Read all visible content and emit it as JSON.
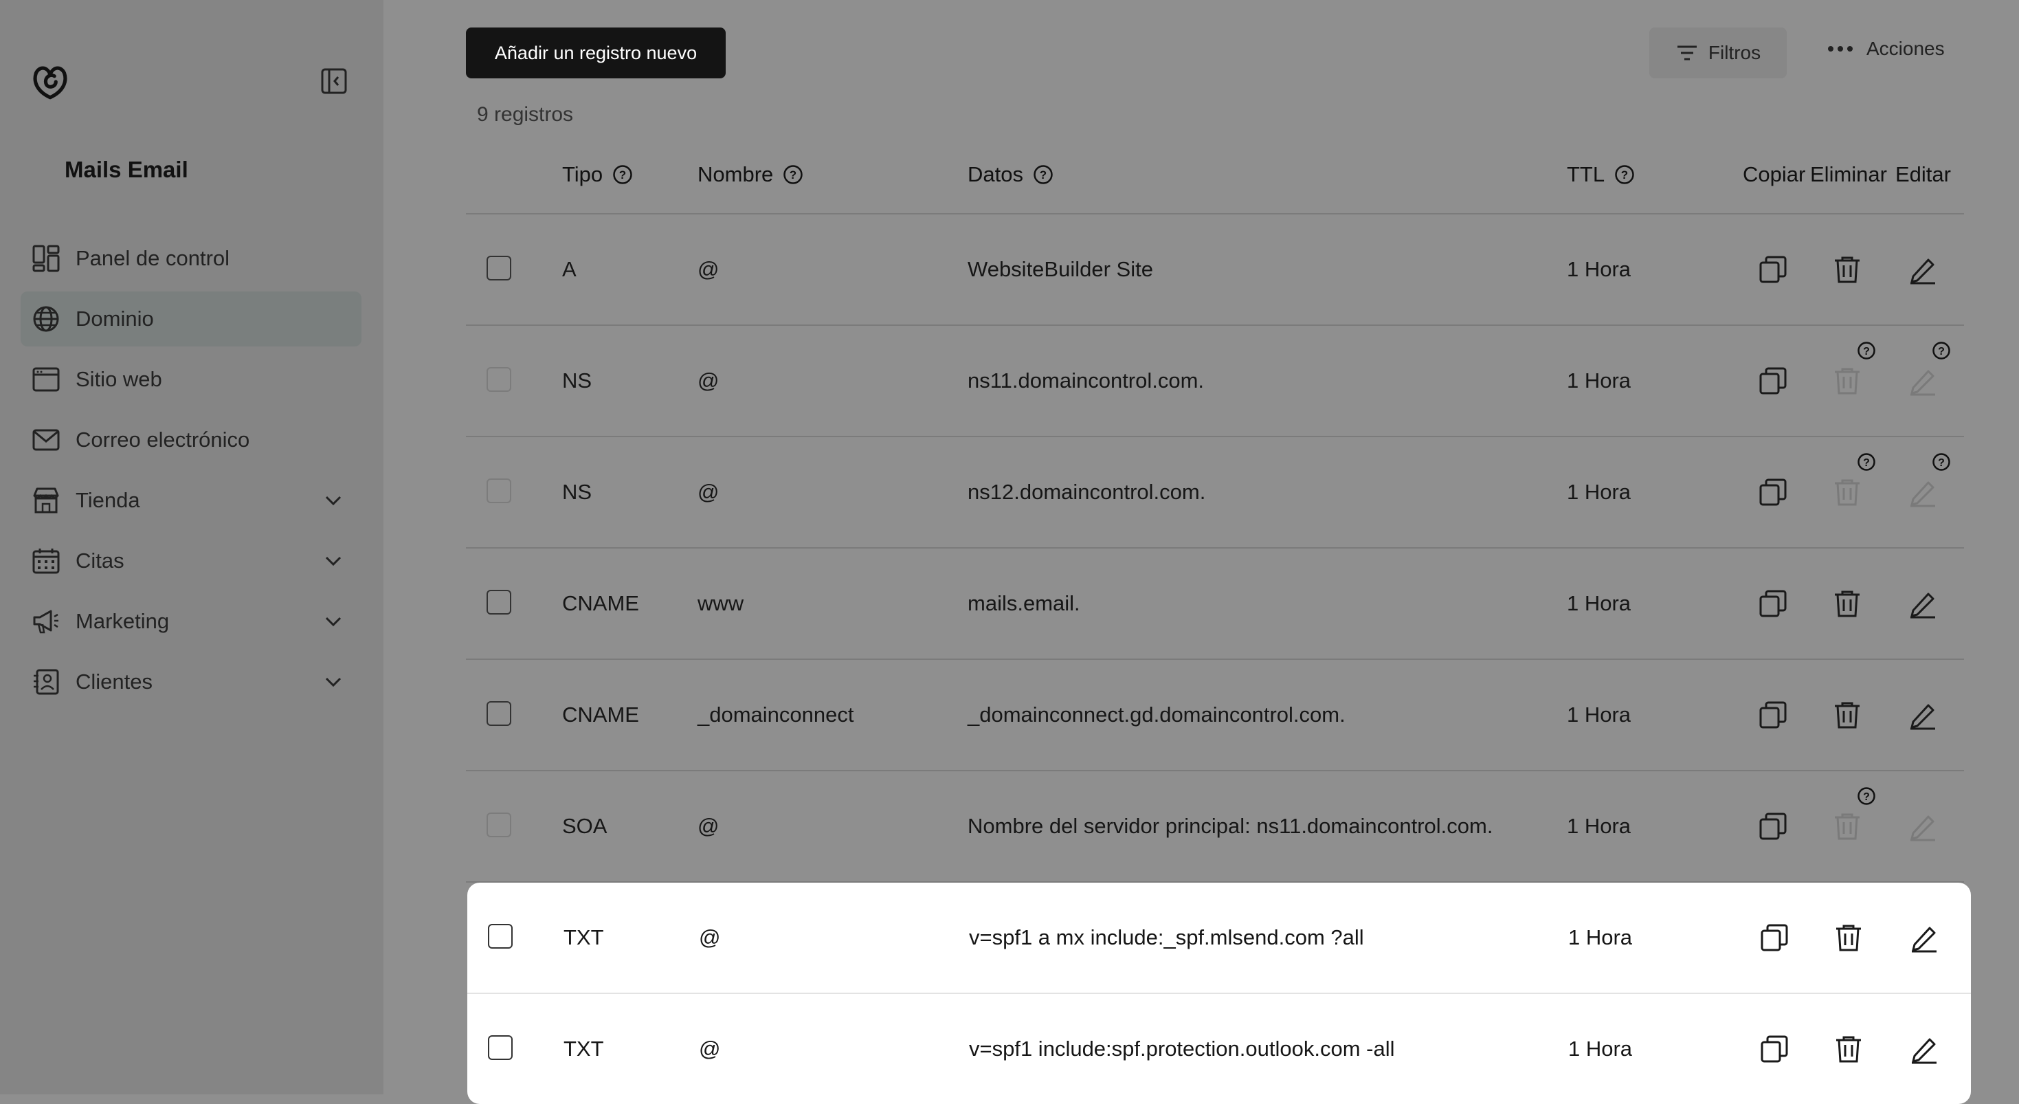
{
  "sidebar": {
    "site_name": "Mails Email",
    "items": [
      {
        "label": "Panel de control",
        "icon": "dashboard-icon",
        "active": false,
        "expandable": false
      },
      {
        "label": "Dominio",
        "icon": "globe-icon",
        "active": true,
        "expandable": false
      },
      {
        "label": "Sitio web",
        "icon": "browser-window-icon",
        "active": false,
        "expandable": false
      },
      {
        "label": "Correo electrónico",
        "icon": "envelope-icon",
        "active": false,
        "expandable": false
      },
      {
        "label": "Tienda",
        "icon": "store-icon",
        "active": false,
        "expandable": true
      },
      {
        "label": "Citas",
        "icon": "calendar-icon",
        "active": false,
        "expandable": true
      },
      {
        "label": "Marketing",
        "icon": "megaphone-icon",
        "active": false,
        "expandable": true
      },
      {
        "label": "Clientes",
        "icon": "contacts-icon",
        "active": false,
        "expandable": true
      }
    ]
  },
  "toolbar": {
    "add_label": "Añadir un registro nuevo",
    "filters_label": "Filtros",
    "actions_label": "Acciones"
  },
  "records_count": "9 registros",
  "table": {
    "headers": {
      "tipo": "Tipo",
      "nombre": "Nombre",
      "datos": "Datos",
      "ttl": "TTL",
      "copiar": "Copiar",
      "eliminar": "Eliminar",
      "editar": "Editar"
    },
    "rows": [
      {
        "tipo": "A",
        "nombre": "@",
        "datos": "WebsiteBuilder Site",
        "ttl": "1 Hora",
        "locked": false,
        "delete_enabled": true,
        "edit_enabled": true,
        "highlight": false
      },
      {
        "tipo": "NS",
        "nombre": "@",
        "datos": "ns11.domaincontrol.com.",
        "ttl": "1 Hora",
        "locked": true,
        "delete_enabled": false,
        "edit_enabled": false,
        "highlight": false
      },
      {
        "tipo": "NS",
        "nombre": "@",
        "datos": "ns12.domaincontrol.com.",
        "ttl": "1 Hora",
        "locked": true,
        "delete_enabled": false,
        "edit_enabled": false,
        "highlight": false
      },
      {
        "tipo": "CNAME",
        "nombre": "www",
        "datos": "mails.email.",
        "ttl": "1 Hora",
        "locked": false,
        "delete_enabled": true,
        "edit_enabled": true,
        "highlight": false
      },
      {
        "tipo": "CNAME",
        "nombre": "_domainconnect",
        "datos": "_domainconnect.gd.domaincontrol.com.",
        "ttl": "1 Hora",
        "locked": false,
        "delete_enabled": true,
        "edit_enabled": true,
        "highlight": false
      },
      {
        "tipo": "SOA",
        "nombre": "@",
        "datos": "Nombre del servidor principal: ns11.domaincontrol.com.",
        "ttl": "1 Hora",
        "locked": true,
        "delete_enabled": false,
        "edit_enabled": false,
        "highlight": false
      },
      {
        "tipo": "TXT",
        "nombre": "@",
        "datos": "v=spf1 a mx include:_spf.mlsend.com ?all",
        "ttl": "1 Hora",
        "locked": false,
        "delete_enabled": true,
        "edit_enabled": true,
        "highlight": true
      },
      {
        "tipo": "TXT",
        "nombre": "@",
        "datos": "v=spf1 include:spf.protection.outlook.com -all",
        "ttl": "1 Hora",
        "locked": false,
        "delete_enabled": true,
        "edit_enabled": true,
        "highlight": true
      }
    ]
  },
  "colors": {
    "overlay": "#8f8f8f",
    "sidebar": "#858585",
    "primary_button": "#141414",
    "highlight_row": "#ffffff"
  }
}
